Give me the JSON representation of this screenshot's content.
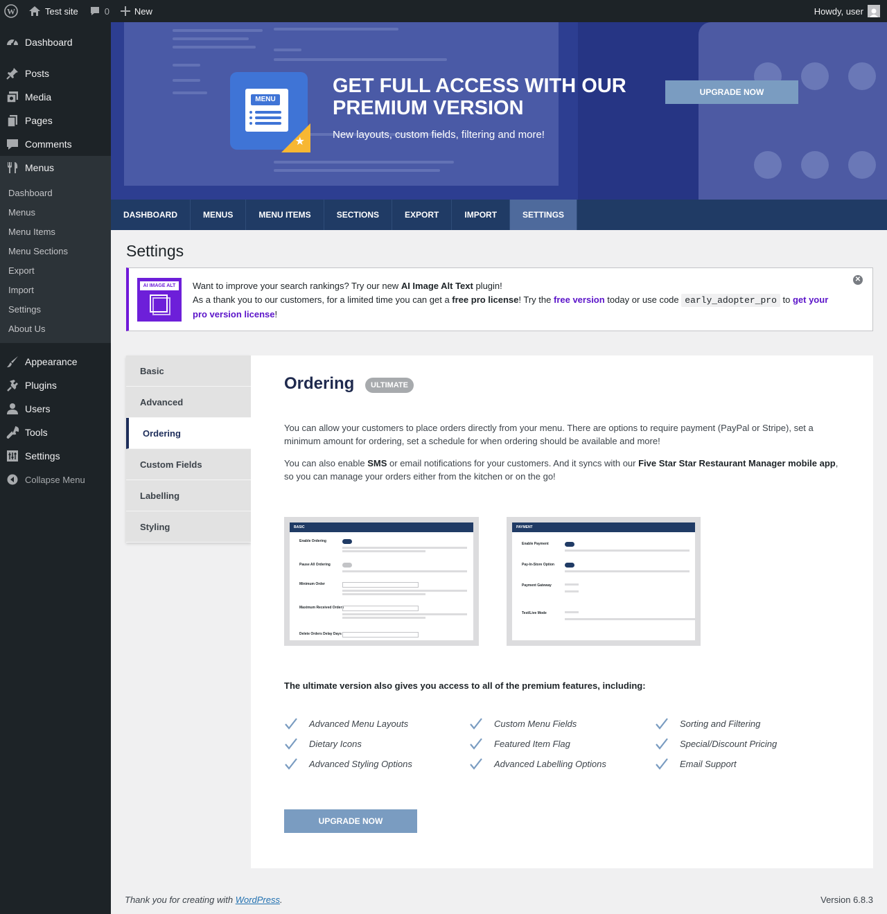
{
  "adminbar": {
    "site_name": "Test site",
    "comments_count": "0",
    "new_label": "New",
    "greeting": "Howdy, user"
  },
  "sidebar": {
    "top_items": [
      {
        "label": "Dashboard",
        "icon": "dashboard-icon"
      },
      {
        "label": "Posts",
        "icon": "pin-icon"
      },
      {
        "label": "Media",
        "icon": "media-icon"
      },
      {
        "label": "Pages",
        "icon": "pages-icon"
      },
      {
        "label": "Comments",
        "icon": "comment-icon"
      },
      {
        "label": "Menus",
        "icon": "fork-knife-icon"
      }
    ],
    "submenu": [
      "Dashboard",
      "Menus",
      "Menu Items",
      "Menu Sections",
      "Export",
      "Import",
      "Settings",
      "About Us"
    ],
    "bottom_items": [
      {
        "label": "Appearance",
        "icon": "brush-icon"
      },
      {
        "label": "Plugins",
        "icon": "plug-icon"
      },
      {
        "label": "Users",
        "icon": "user-icon"
      },
      {
        "label": "Tools",
        "icon": "wrench-icon"
      },
      {
        "label": "Settings",
        "icon": "settings-icon"
      }
    ],
    "collapse_label": "Collapse Menu"
  },
  "banner": {
    "icon_tag": "MENU",
    "title": "GET FULL ACCESS WITH OUR PREMIUM VERSION",
    "subtitle": "New layouts, custom fields, filtering and more!",
    "button": "UPGRADE NOW"
  },
  "plugin_nav": [
    "DASHBOARD",
    "MENUS",
    "MENU ITEMS",
    "SECTIONS",
    "EXPORT",
    "IMPORT",
    "SETTINGS"
  ],
  "plugin_nav_active": "SETTINGS",
  "page_title": "Settings",
  "notice": {
    "logo_text": "AI IMAGE ALT TEXT",
    "line1_pre": "Want to improve your search rankings? Try our new ",
    "line1_bold": "AI Image Alt Text",
    "line1_post": " plugin!",
    "line2_pre": "As a thank you to our customers, for a limited time you can get a ",
    "line2_bold": "free pro license",
    "line2_mid": "! Try the ",
    "line2_link1": "free version",
    "line2_mid2": " today or use code ",
    "code": "early_adopter_pro",
    "line2_mid3": " to ",
    "line2_link2": "get your pro version license",
    "line2_end": "!",
    "close_icon": "close-icon"
  },
  "tabs": [
    "Basic",
    "Advanced",
    "Ordering",
    "Custom Fields",
    "Labelling",
    "Styling"
  ],
  "active_tab": "Ordering",
  "panel": {
    "title": "Ordering",
    "badge": "ULTIMATE",
    "para1": "You can allow your customers to place orders directly from your menu. There are options to require payment (PayPal or Stripe), set a minimum amount for ordering, set a schedule for when ordering should be available and more!",
    "para2_pre": "You can also enable ",
    "para2_b1": "SMS",
    "para2_mid": " or email notifications for your customers. And it syncs with our ",
    "para2_b2": "Five Star Star Restaurant Manager mobile app",
    "para2_end": ", so you can manage your orders either from the kitchen or on the go!",
    "shot1": {
      "header": "BASIC",
      "rows": [
        "Enable Ordering",
        "Pause All Ordering",
        "Minimum Order",
        "Maximum Received Orders",
        "Delete Orders Delay Days"
      ]
    },
    "shot2": {
      "header": "PAYMENT",
      "rows": [
        "Enable Payment",
        "Pay-In-Store Option",
        "Payment Gateway",
        "Test/Live Mode"
      ]
    },
    "features_head": "The ultimate version also gives you access to all of the premium features, including:",
    "features": [
      "Advanced Menu Layouts",
      "Custom Menu Fields",
      "Sorting and Filtering",
      "Dietary Icons",
      "Featured Item Flag",
      "Special/Discount Pricing",
      "Advanced Styling Options",
      "Advanced Labelling Options",
      "Email Support"
    ],
    "button": "UPGRADE NOW"
  },
  "footer": {
    "thanks_pre": "Thank you for creating with ",
    "thanks_link": "WordPress",
    "thanks_post": ".",
    "version": "Version 6.8.3"
  },
  "colors": {
    "accent": "#203b65",
    "banner": "#2d3e91",
    "button": "#7a9cc1",
    "notice_border": "#7018d8"
  }
}
